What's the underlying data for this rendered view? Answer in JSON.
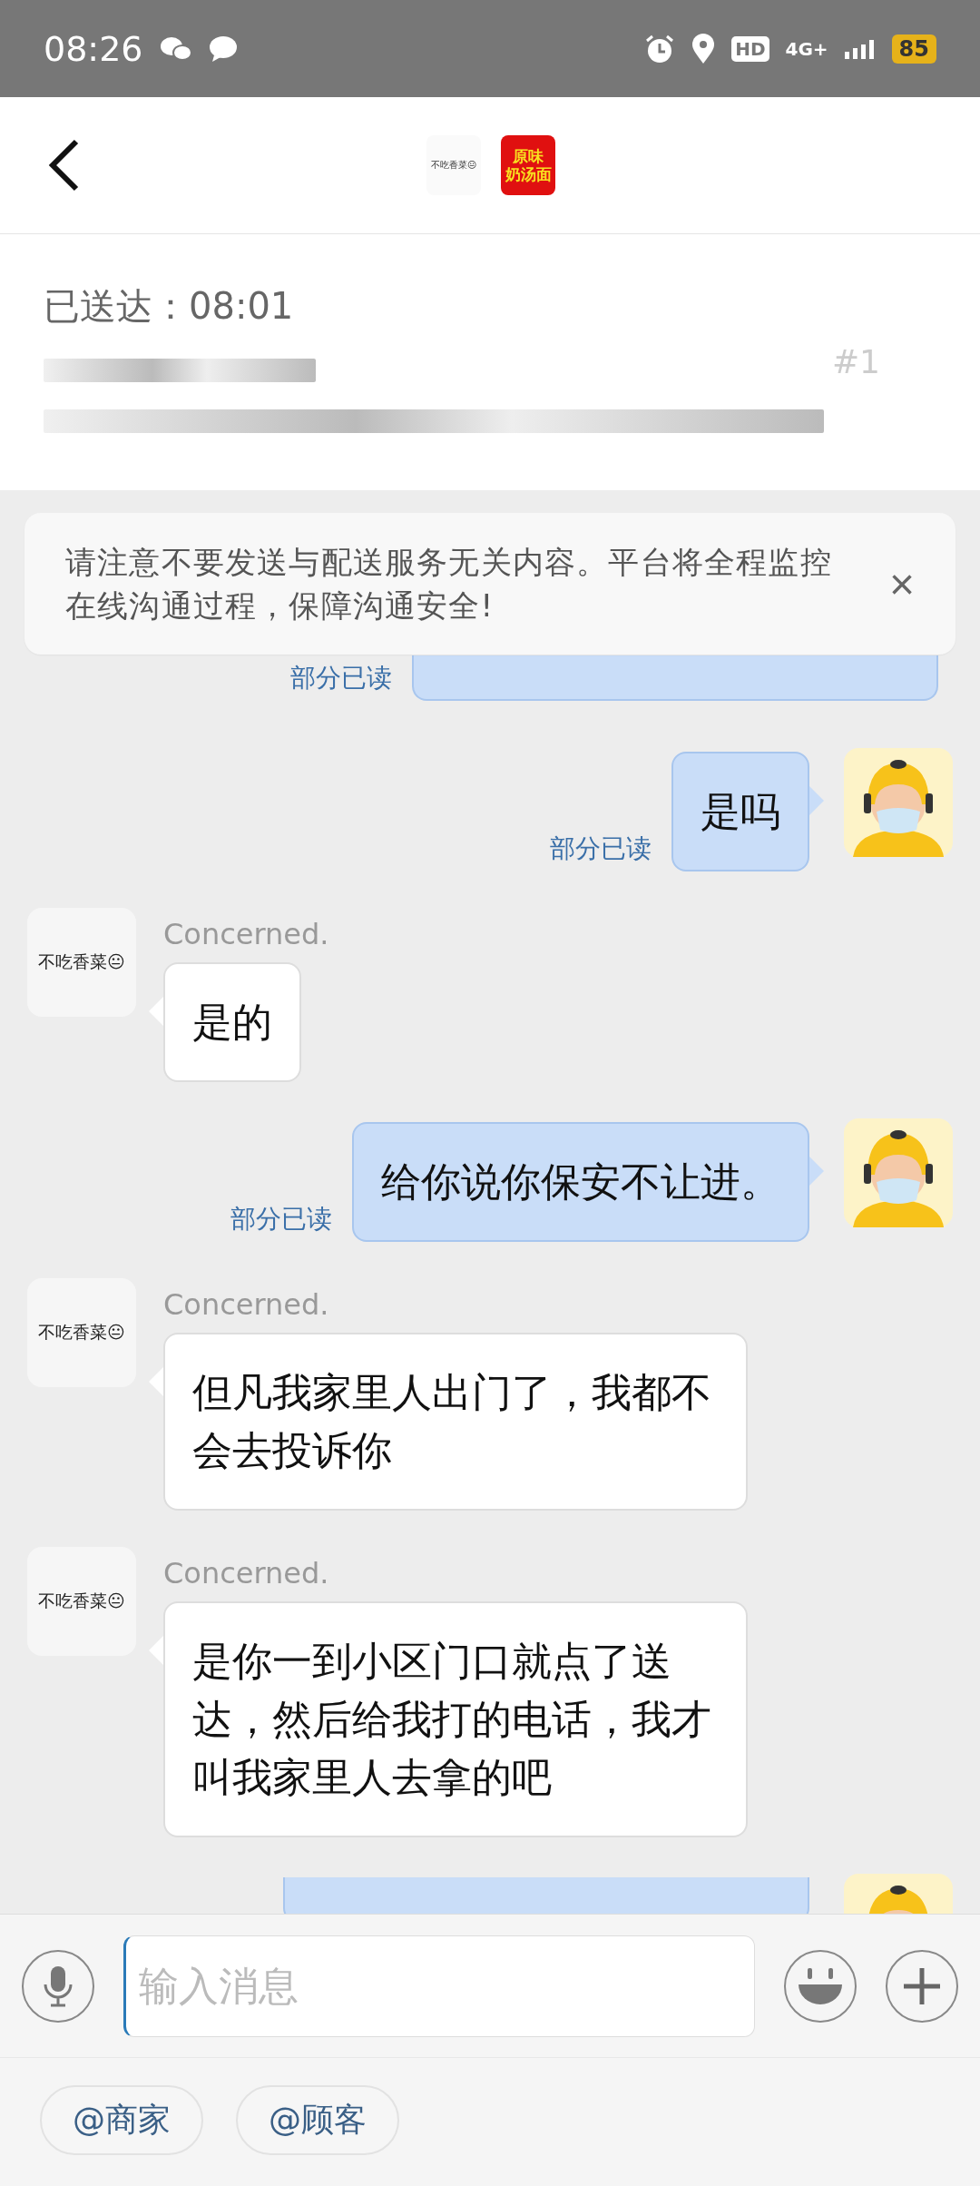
{
  "status_bar": {
    "time": "08:26",
    "hd": "HD",
    "network": "4G+",
    "battery": "85"
  },
  "header": {
    "customer_avatar": "不吃香菜😐",
    "shop_logo": [
      "原味",
      "奶汤面"
    ]
  },
  "order": {
    "delivered": "已送达：08:01",
    "number": "#1"
  },
  "notice": {
    "text": "请注意不要发送与配送服务无关内容。平台将全程监控在线沟通过程，保障沟通安全!",
    "close": "×"
  },
  "messages": [
    {
      "kind": "outgoing",
      "read_status": "部分已读"
    },
    {
      "kind": "outgoing",
      "text": "是吗",
      "read_status": "部分已读"
    },
    {
      "kind": "incoming",
      "sender": "Concerned.",
      "avatar": "不吃香菜😐",
      "text": "是的"
    },
    {
      "kind": "outgoing",
      "text": "给你说你保安不让进。",
      "read_status": "部分已读"
    },
    {
      "kind": "incoming",
      "sender": "Concerned.",
      "avatar": "不吃香菜😐",
      "text": "但凡我家里人出门了，我都不会去投诉你"
    },
    {
      "kind": "incoming",
      "sender": "Concerned.",
      "avatar": "不吃香菜😐",
      "text": "是你一到小区门口就点了送达，然后给我打的电话，我才叫我家里人去拿的吧"
    },
    {
      "kind": "outgoing"
    }
  ],
  "input": {
    "placeholder": "输入消息"
  },
  "quick_replies": [
    "@商家",
    "@顾客"
  ]
}
